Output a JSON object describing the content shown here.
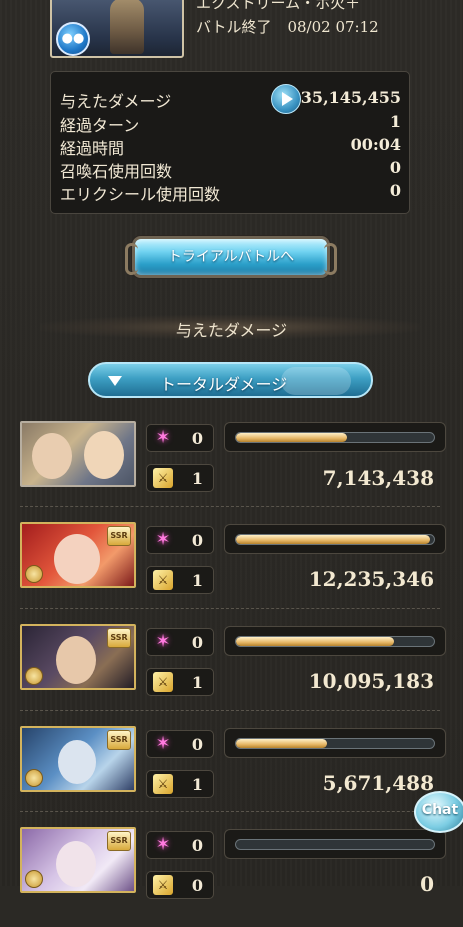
{
  "header": {
    "quest_name": "エクストリーム・ホ火＋",
    "status": "バトル終了",
    "timestamp": "08/02 07:12"
  },
  "stats": [
    {
      "label": "与えたダメージ",
      "value": "35,145,455"
    },
    {
      "label": "経過ターン",
      "value": "1"
    },
    {
      "label": "経過時間",
      "value": "00:04"
    },
    {
      "label": "召喚石使用回数",
      "value": "0"
    },
    {
      "label": "エリクシール使用回数",
      "value": "0"
    }
  ],
  "trial_button": {
    "label": "トライアルバトルへ"
  },
  "section_title": "与えたダメージ",
  "dropdown": {
    "selected": "トータルダメージ"
  },
  "characters": [
    {
      "ssr": "",
      "ougi_count": "0",
      "attack_count": "1",
      "damage": "7,143,438",
      "gauge_fraction": 0.56
    },
    {
      "ssr": "SSR",
      "ougi_count": "0",
      "attack_count": "1",
      "damage": "12,235,346",
      "gauge_fraction": 0.98
    },
    {
      "ssr": "SSR",
      "ougi_count": "0",
      "attack_count": "1",
      "damage": "10,095,183",
      "gauge_fraction": 0.8
    },
    {
      "ssr": "SSR",
      "ougi_count": "0",
      "attack_count": "1",
      "damage": "5,671,488",
      "gauge_fraction": 0.46
    },
    {
      "ssr": "SSR",
      "ougi_count": "0",
      "attack_count": "0",
      "damage": "0",
      "gauge_fraction": 0.0
    }
  ],
  "chat": {
    "label": "Chat"
  },
  "colors": {
    "background": "#2b2925",
    "accent_blue": "#3d9fc3",
    "gauge_gold": "#e6b767",
    "ougi_pink": "#ff7adf"
  }
}
